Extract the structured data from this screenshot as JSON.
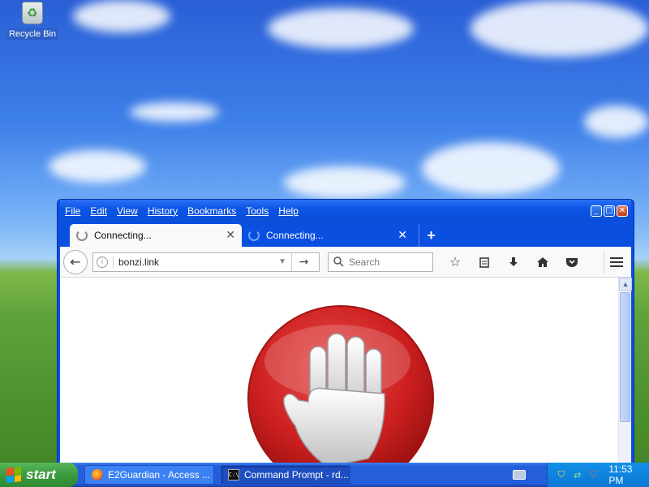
{
  "desktop": {
    "icons": [
      {
        "label": "Recycle Bin",
        "icon": "recycle-bin-icon"
      }
    ]
  },
  "window": {
    "menu": [
      "File",
      "Edit",
      "View",
      "History",
      "Bookmarks",
      "Tools",
      "Help"
    ],
    "controls": {
      "minimize": "_",
      "maximize": "□",
      "close": "✕"
    },
    "tabs": [
      {
        "title": "Connecting...",
        "close": "✕",
        "active": true
      },
      {
        "title": "Connecting...",
        "close": "✕",
        "active": false
      }
    ],
    "new_tab": "+",
    "url": {
      "value": "bonzi.link",
      "info": "i",
      "dropdown": "▼",
      "go": "→"
    },
    "search": {
      "placeholder": "Search"
    },
    "toolbar_icons": [
      "star-icon",
      "reading-list-icon",
      "download-icon",
      "home-icon",
      "pocket-icon",
      "hamburger-menu-icon"
    ]
  },
  "page": {
    "image": "stop-hand-icon",
    "colors": {
      "stop_red": "#cc1f1f",
      "hand": "#d9d9d9"
    }
  },
  "taskbar": {
    "start_label": "start",
    "tasks": [
      {
        "label": "E2Guardian - Access ...",
        "icon": "firefox-icon",
        "active": false
      },
      {
        "label": "Command Prompt - rd...",
        "icon": "cmd-icon",
        "active": true
      }
    ],
    "clock": "11:53 PM"
  }
}
